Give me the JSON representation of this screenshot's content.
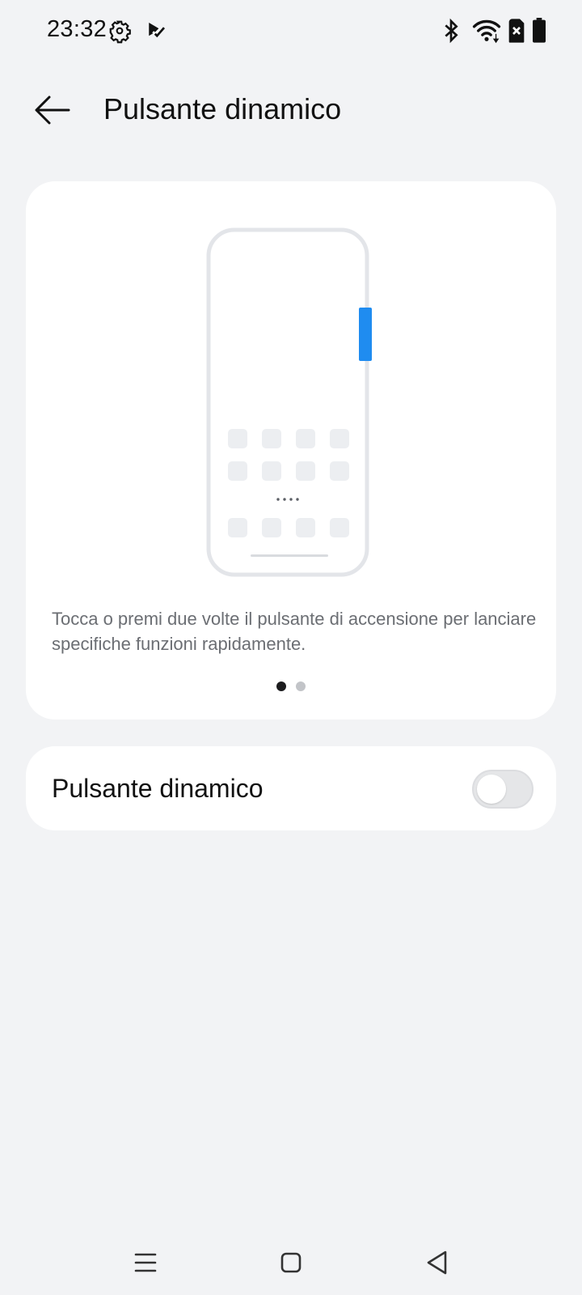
{
  "status_bar": {
    "time": "23:32",
    "left_icons": [
      "gear-icon",
      "play-check-icon"
    ],
    "right_icons": [
      "bluetooth-icon",
      "wifi-icon",
      "sim-error-icon",
      "battery-icon"
    ]
  },
  "header": {
    "title": "Pulsante dinamico",
    "back_icon": "arrow-left-icon"
  },
  "illustration": {
    "description": "Tocca o premi due volte il pulsante di accensione per lanciare specifiche funzioni rapidamente.",
    "page_count": 2,
    "active_page": 1,
    "accent_color": "#1f8cf0"
  },
  "settings": {
    "toggle_label": "Pulsante dinamico",
    "toggle_on": false
  },
  "nav_bar": {
    "icons": [
      "menu-icon",
      "home-square-icon",
      "back-triangle-icon"
    ]
  }
}
